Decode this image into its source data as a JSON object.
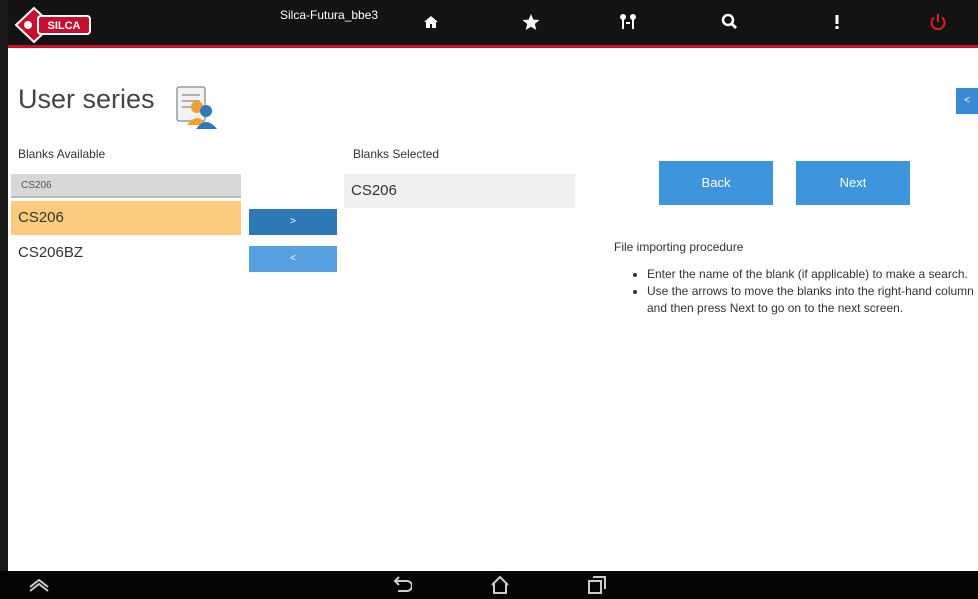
{
  "header": {
    "logo_text": "SILCA",
    "app_title": "Silca-Futura_bbe3",
    "icons": [
      "home-icon",
      "star-icon",
      "keys-icon",
      "search-icon",
      "info-icon",
      "power-icon"
    ],
    "power_color": "#e02020",
    "accent_line_color": "#c8102e"
  },
  "page": {
    "title": "User series",
    "title_icon": "user-document-icon",
    "collapse_label": "<"
  },
  "available": {
    "label": "Blanks Available",
    "search_value": "CS206",
    "items": [
      {
        "label": "CS206",
        "selected": true
      },
      {
        "label": "CS206BZ",
        "selected": false
      }
    ]
  },
  "move_buttons": {
    "add_label": ">",
    "remove_label": "<"
  },
  "selected": {
    "label": "Blanks Selected",
    "items": [
      {
        "label": "CS206"
      }
    ]
  },
  "nav": {
    "back_label": "Back",
    "next_label": "Next"
  },
  "procedure": {
    "title": "File importing procedure",
    "steps": [
      "Enter the name of the blank (if applicable) to make a search.",
      "Use the arrows to move the blanks into the right-hand column and then press Next to go on to the next screen."
    ]
  },
  "system_bar": {
    "icons": [
      "chevron-up-icon",
      "back-icon",
      "home-outline-icon",
      "recent-apps-icon"
    ]
  },
  "colors": {
    "primary_button": "#3e95dc",
    "selected_row": "#fbcb7e",
    "topbar": "#131313"
  }
}
